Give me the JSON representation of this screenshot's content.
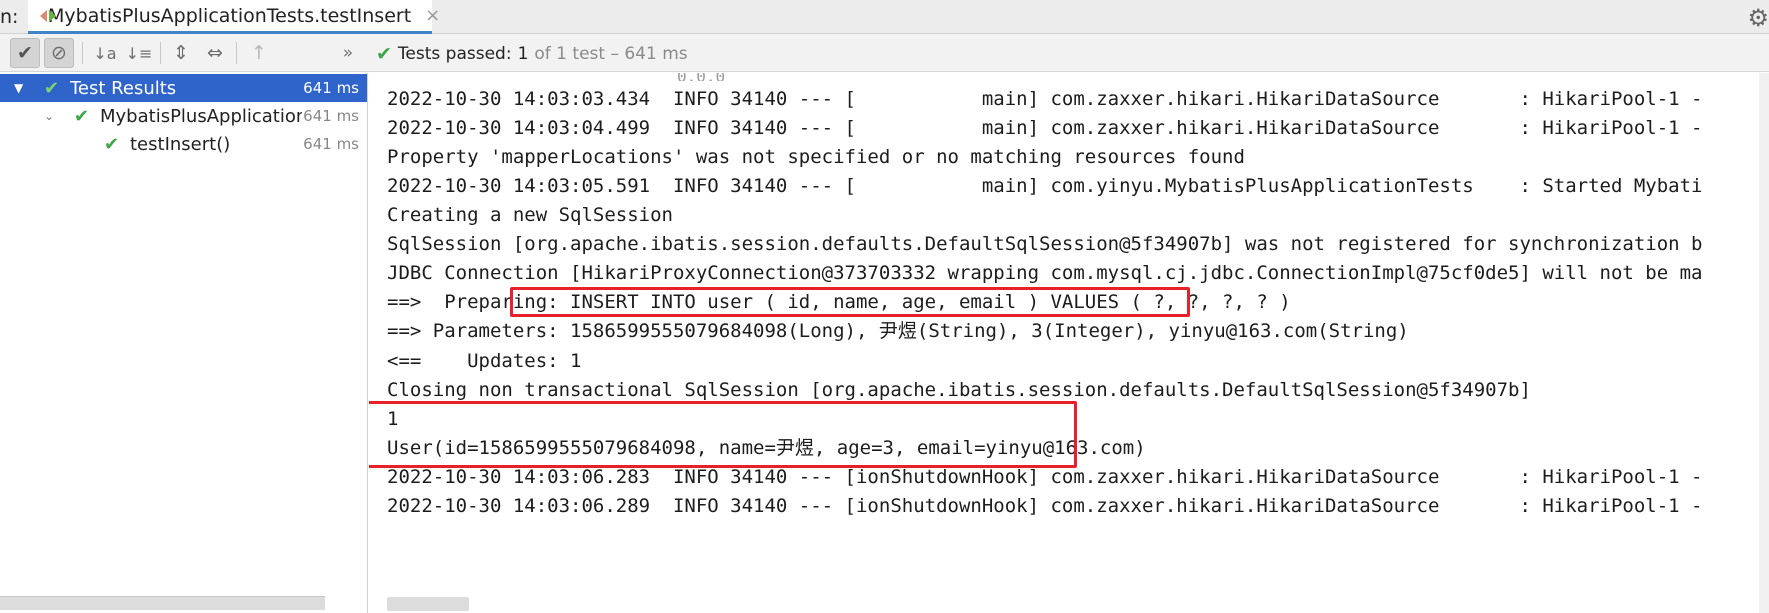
{
  "run_label": "n:",
  "tab": {
    "title": "MybatisPlusApplicationTests.testInsert",
    "close": "×"
  },
  "toolbar": {
    "buttons": [
      {
        "icon": "check-icon",
        "glyph": "✔"
      },
      {
        "icon": "stop-icon",
        "glyph": "⊘"
      },
      {
        "icon": "sort-alpha-icon",
        "glyph": "↓a"
      },
      {
        "icon": "sort-duration-icon",
        "glyph": "↓≡"
      },
      {
        "icon": "expand-all-icon",
        "glyph": "⇕"
      },
      {
        "icon": "collapse-all-icon",
        "glyph": "⇔"
      },
      {
        "icon": "up-arrow-icon",
        "glyph": "↑"
      },
      {
        "icon": "more-icon",
        "glyph": "»"
      }
    ],
    "status": {
      "label": "Tests passed:",
      "count": "1",
      "detail": "of 1 test – 641 ms"
    }
  },
  "tree": {
    "items": [
      {
        "name": "Test Results",
        "time": "641 ms"
      },
      {
        "name": "MybatisPlusApplication",
        "time": "641 ms"
      },
      {
        "name": "testInsert()",
        "time": "641 ms"
      }
    ]
  },
  "console": {
    "lines": [
      "2022-10-30 14:03:03.434  INFO 34140 --- [           main] com.zaxxer.hikari.HikariDataSource       : HikariPool-1 -",
      "2022-10-30 14:03:04.499  INFO 34140 --- [           main] com.zaxxer.hikari.HikariDataSource       : HikariPool-1 -",
      "Property 'mapperLocations' was not specified or no matching resources found",
      "2022-10-30 14:03:05.591  INFO 34140 --- [           main] com.yinyu.MybatisPlusApplicationTests    : Started Mybati",
      "Creating a new SqlSession",
      "SqlSession [org.apache.ibatis.session.defaults.DefaultSqlSession@5f34907b] was not registered for synchronization b",
      "JDBC Connection [HikariProxyConnection@373703332 wrapping com.mysql.cj.jdbc.ConnectionImpl@75cf0de5] will not be ma",
      "==>  Preparing: INSERT INTO user ( id, name, age, email ) VALUES ( ?, ?, ?, ? )",
      "==> Parameters: 1586599555079684098(Long), 尹煜(String), 3(Integer), yinyu@163.com(String)",
      "<==    Updates: 1",
      "Closing non transactional SqlSession [org.apache.ibatis.session.defaults.DefaultSqlSession@5f34907b]",
      "1",
      "User(id=1586599555079684098, name=尹煜, age=3, email=yinyu@163.com)",
      "2022-10-30 14:03:06.283  INFO 34140 --- [ionShutdownHook] com.zaxxer.hikari.HikariDataSource       : HikariPool-1 -",
      "2022-10-30 14:03:06.289  INFO 34140 --- [ionShutdownHook] com.zaxxer.hikari.HikariDataSource       : HikariPool-1 -"
    ]
  },
  "colors": {
    "highlight": "#e8202a",
    "selection": "#2f65ca",
    "pass": "#3ea64a"
  }
}
